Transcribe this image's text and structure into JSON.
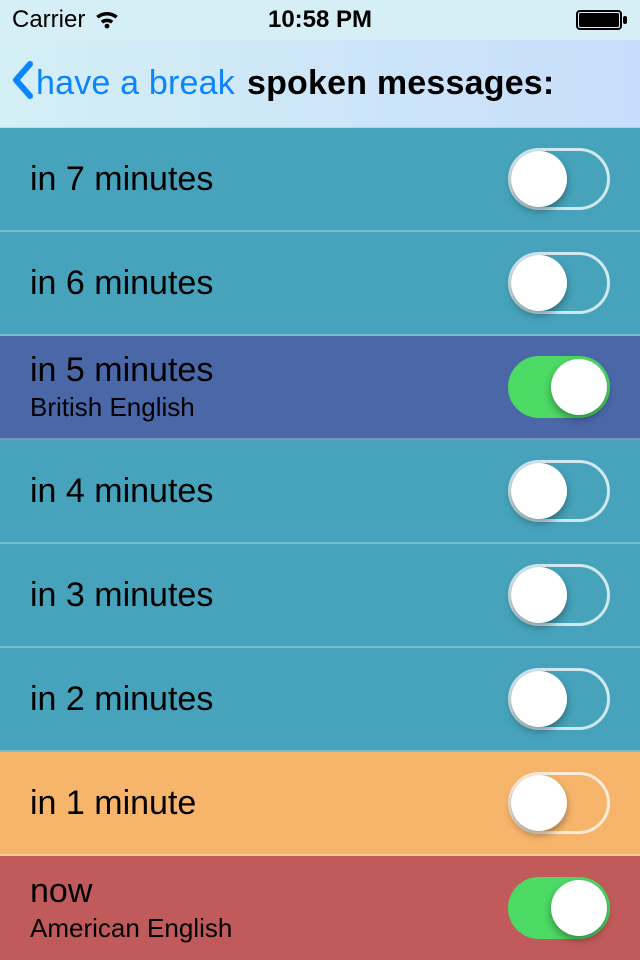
{
  "status": {
    "carrier": "Carrier",
    "time": "10:58 PM"
  },
  "nav": {
    "back_label": "have a break",
    "title": "spoken messages:"
  },
  "rows": [
    {
      "title": "in 7 minutes",
      "sub": "",
      "on": false,
      "bg": "bg-teal"
    },
    {
      "title": "in 6 minutes",
      "sub": "",
      "on": false,
      "bg": "bg-teal"
    },
    {
      "title": "in 5 minutes",
      "sub": "British English",
      "on": true,
      "bg": "bg-indigo"
    },
    {
      "title": "in 4 minutes",
      "sub": "",
      "on": false,
      "bg": "bg-teal"
    },
    {
      "title": "in 3 minutes",
      "sub": "",
      "on": false,
      "bg": "bg-teal"
    },
    {
      "title": "in 2 minutes",
      "sub": "",
      "on": false,
      "bg": "bg-teal"
    },
    {
      "title": "in 1 minute",
      "sub": "",
      "on": false,
      "bg": "bg-orange"
    },
    {
      "title": "now",
      "sub": "American English",
      "on": true,
      "bg": "bg-red"
    }
  ]
}
